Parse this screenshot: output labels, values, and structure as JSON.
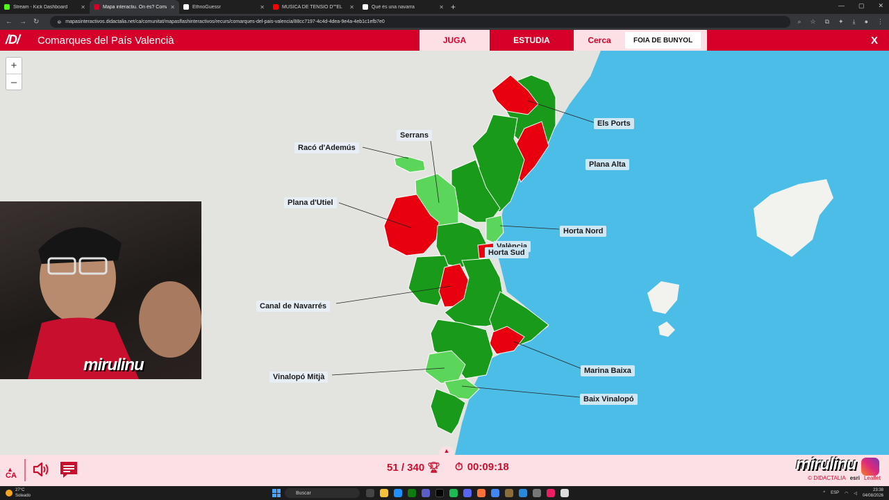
{
  "browser": {
    "tabs": [
      {
        "label": "Stream - Kick Dashboard",
        "color": "#53fc18",
        "active": false
      },
      {
        "label": "Mapa interactiu. On és? Comarque",
        "color": "#d4002a",
        "active": true
      },
      {
        "label": "EthnoGuessr",
        "color": "#ffffff",
        "active": false
      },
      {
        "label": "MÚSICA DE TENSIÓ D\"\"EL",
        "color": "#ff0000",
        "active": false
      },
      {
        "label": "Què és una navarra",
        "color": "#ffffff",
        "active": false
      }
    ],
    "url": "mapasinteractivos.didactalia.net/ca/comunitat/mapasflashinteractivos/recurs/comarques-del-pais-valencia/88cc7197-4c4d-4dea-9e4a-4eb1c1efb7e0"
  },
  "app": {
    "logo": "/D/",
    "title": "Comarques del País Valencià",
    "modes": {
      "play": "JUGA",
      "study": "ESTUDIA"
    },
    "search_label": "Cerca",
    "search_target": "FOIA DE BUNYOL",
    "close": "X"
  },
  "zoom": {
    "in": "+",
    "out": "–"
  },
  "map_labels": [
    "Serrans",
    "Racó d'Ademús",
    "Plana d'Utiel",
    "Els Ports",
    "Plana Alta",
    "Horta Nord",
    "València",
    "Horta Sud",
    "Canal de Navarrés",
    "Marina Baixa",
    "Vinalopó Mitjà",
    "Baix Vinalopó"
  ],
  "colors": {
    "correct": "#1a9a1a",
    "correct_light": "#5bd65b",
    "wrong": "#e8000f",
    "sea": "#4cbde6",
    "land": "#e3e4df",
    "brand": "#d4002a"
  },
  "overlay": {
    "streamer_tag": "mirulinu"
  },
  "footer": {
    "lang": "CA",
    "score": "51 / 340",
    "timer": "00:09:18",
    "brand": "mirulinu",
    "credits_didactalia": "© DIDACTALIA",
    "credits_esri": "esri",
    "credits_leaflet": "Leaflet"
  },
  "taskbar": {
    "weather_temp": "27°C",
    "weather_desc": "Soleado",
    "search": "Buscar",
    "lang": "ESP",
    "time": "23:38",
    "date": "04/08/2026"
  }
}
